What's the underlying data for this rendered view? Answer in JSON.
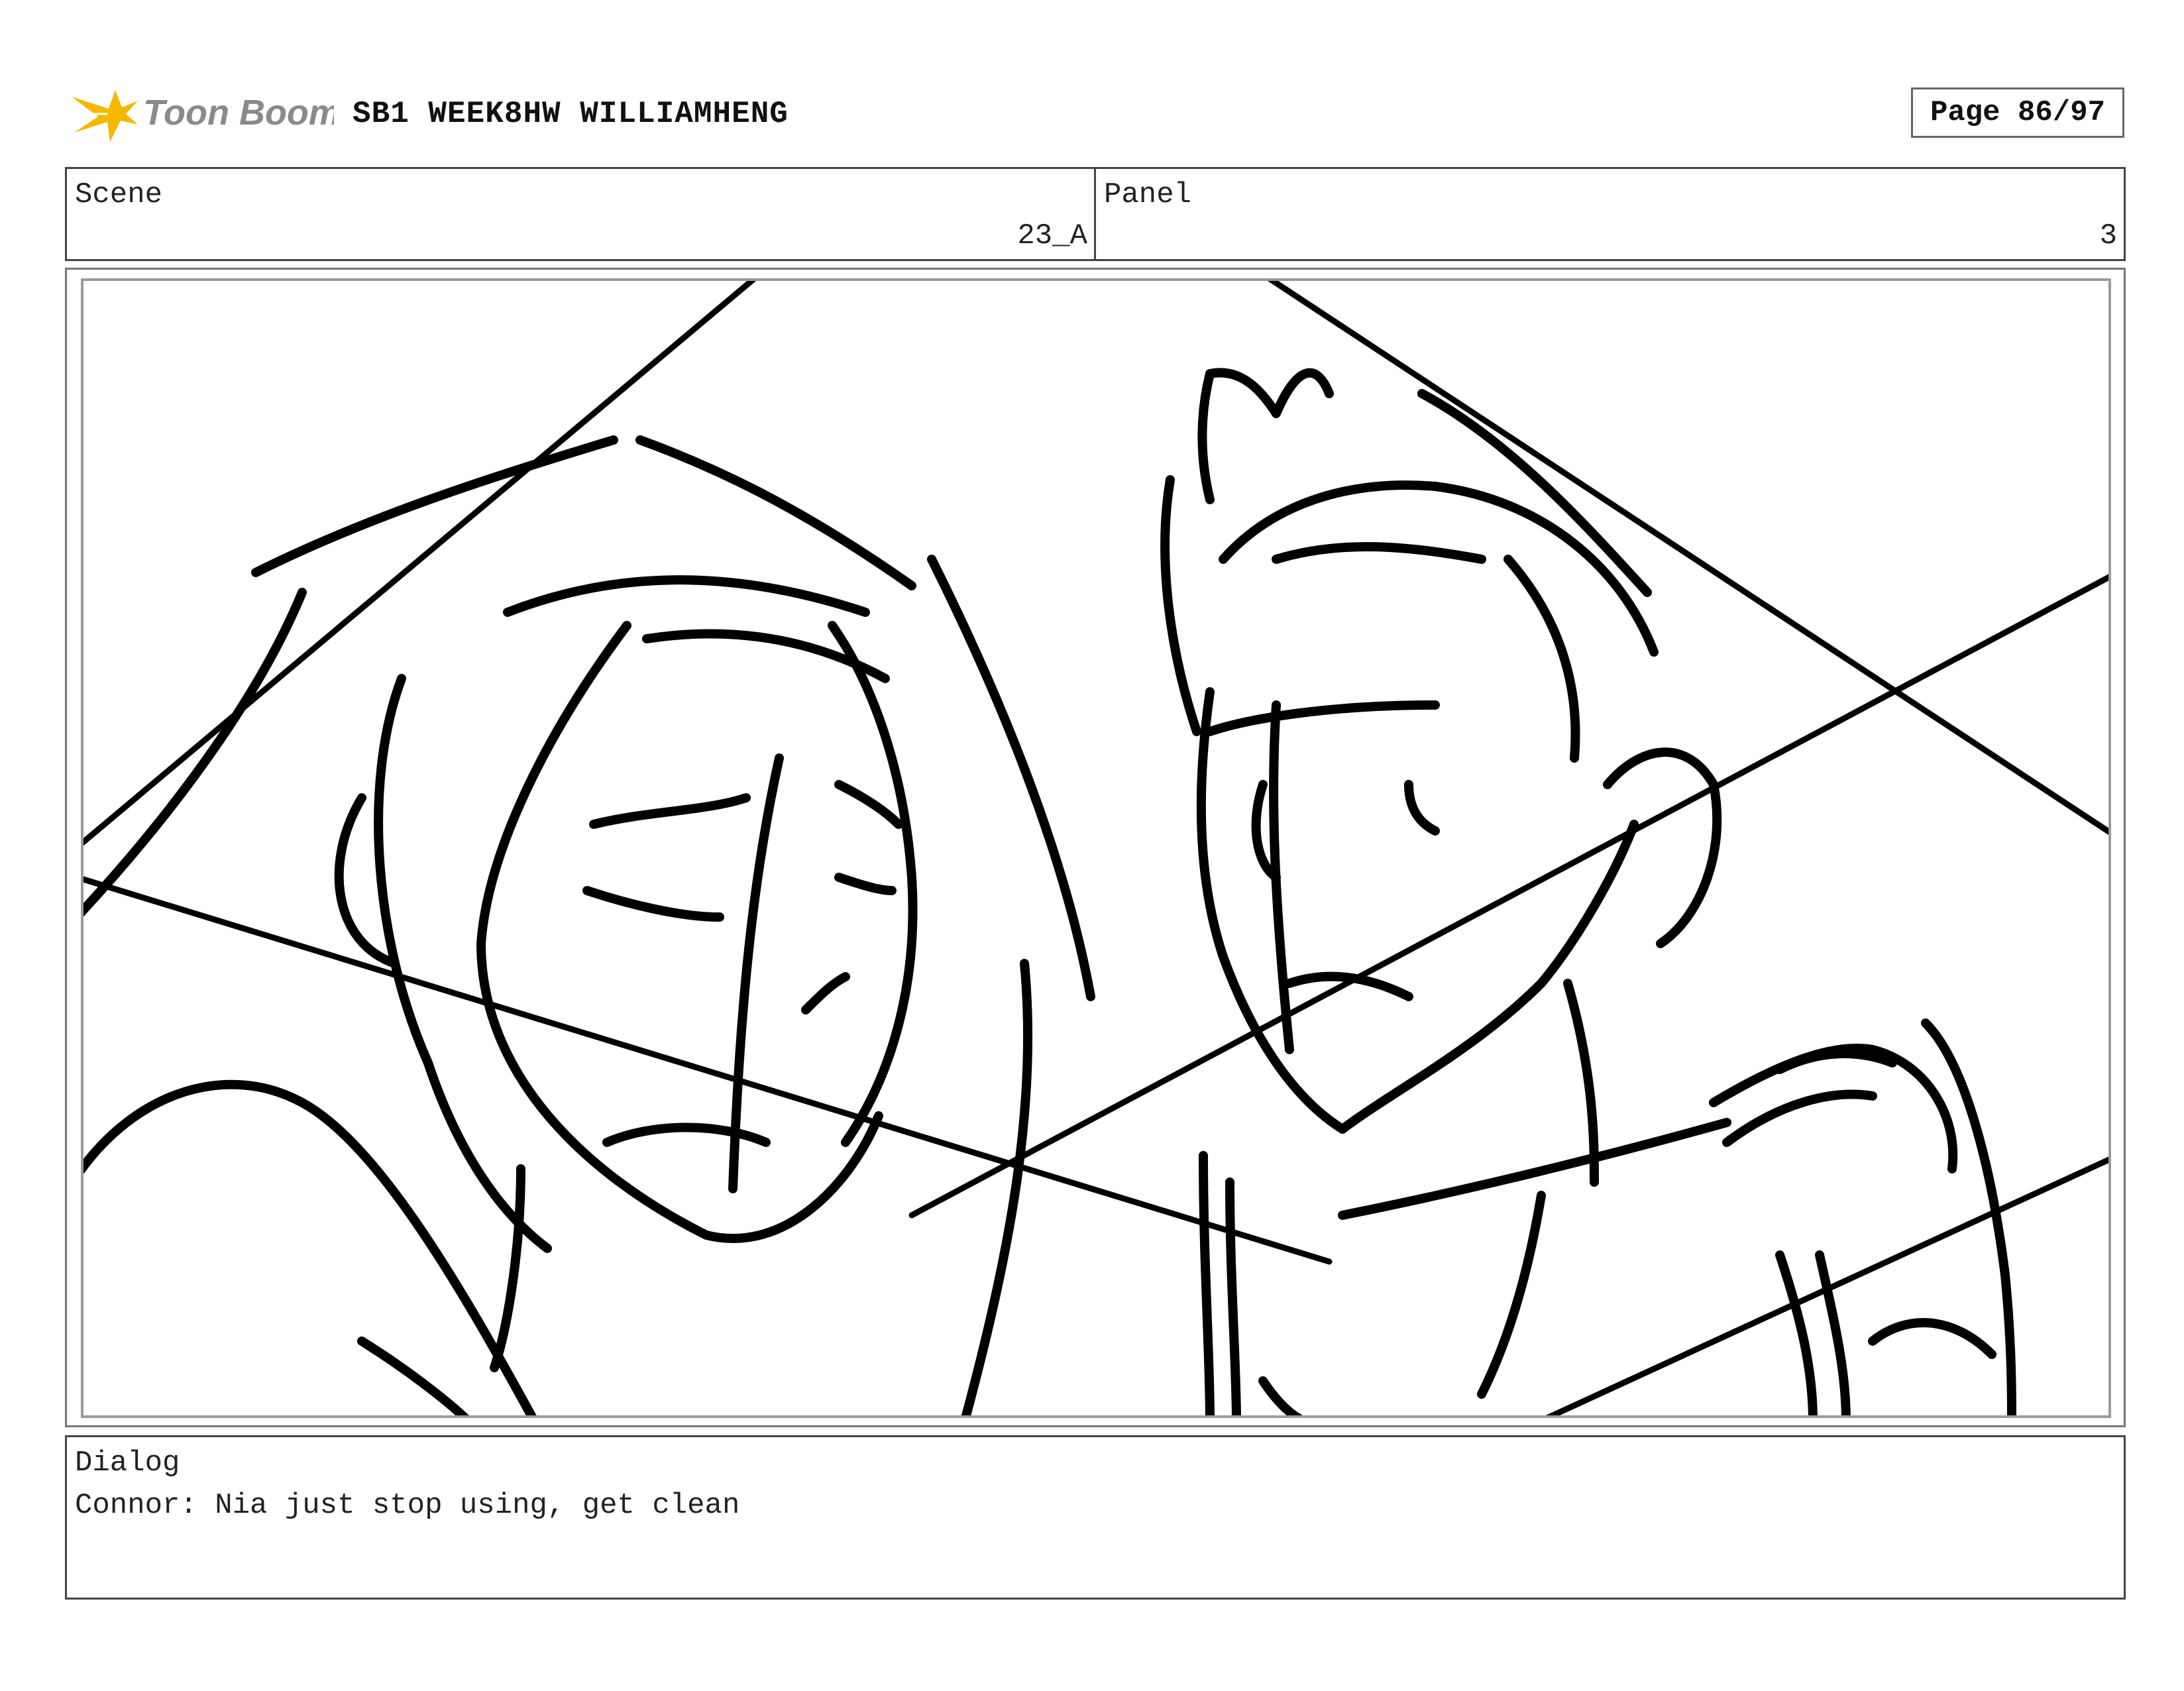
{
  "header": {
    "logo_text": "Toon Boom",
    "project_title": "SB1 WEEK8HW WILLIAMHENG",
    "page_label": "Page 86/97"
  },
  "scene": {
    "label": "Scene",
    "value": "23_A"
  },
  "panel": {
    "label": "Panel",
    "value": "3"
  },
  "dialog": {
    "label": "Dialog",
    "text": "Connor: Nia just stop using, get clean"
  },
  "colors": {
    "logo_star": "#f5b800",
    "logo_text": "#8a8a8a",
    "sketch_line": "#000000",
    "frame_border": "#777777"
  }
}
